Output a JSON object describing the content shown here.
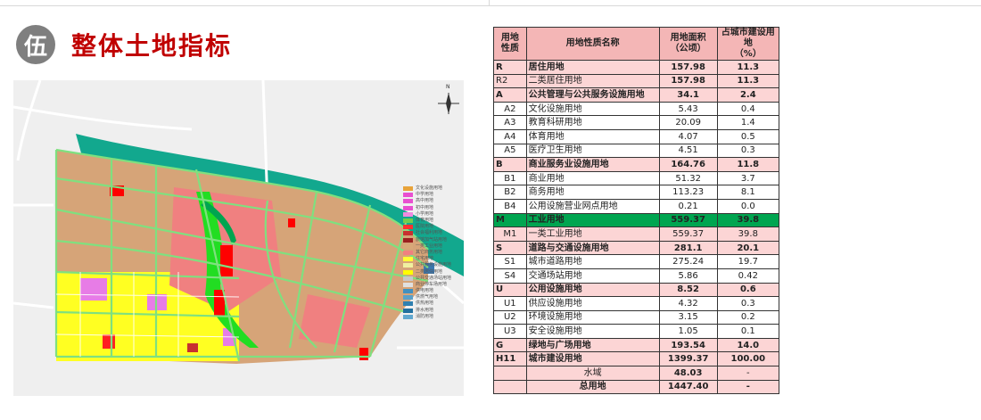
{
  "header": {
    "badge": "伍",
    "title": "整体土地指标"
  },
  "map": {
    "compass": "N",
    "legend": [
      {
        "label": "文化设施用地",
        "color": "#e8a33a"
      },
      {
        "label": "中学用地",
        "color": "#e84fd0"
      },
      {
        "label": "高中用地",
        "color": "#e84fd0"
      },
      {
        "label": "初中用地",
        "color": "#e84fd0"
      },
      {
        "label": "小学用地",
        "color": "#f08ae0"
      },
      {
        "label": "体育用地",
        "color": "#6fcf4f"
      },
      {
        "label": "医院用地",
        "color": "#ff3030"
      },
      {
        "label": "社会福利用地",
        "color": "#c83030"
      },
      {
        "label": "旅馆加气站用地",
        "color": "#9a2020"
      },
      {
        "label": "一类工业用地",
        "color": "#d8a878"
      },
      {
        "label": "其它商务用地",
        "color": "#f08080"
      },
      {
        "label": "住宅用地",
        "color": "#ffff33"
      },
      {
        "label": "公共服务设施用地",
        "color": "#f0f0a0"
      },
      {
        "label": "二类居住用地",
        "color": "#ffff00"
      },
      {
        "label": "公共交通场站用地",
        "color": "#c8c8c8"
      },
      {
        "label": "商业停车场用地",
        "color": "#e0e0e0"
      },
      {
        "label": "供电用地",
        "color": "#4090c0"
      },
      {
        "label": "供燃气用地",
        "color": "#5aa0c8"
      },
      {
        "label": "供热用地",
        "color": "#3080b0"
      },
      {
        "label": "排水用地",
        "color": "#2070a0"
      },
      {
        "label": "消防用地",
        "color": "#60a8d0"
      }
    ]
  },
  "table": {
    "headers": [
      "用地\n性质",
      "用地性质名称",
      "用地面积\n（公顷）",
      "占城市建设用地\n（%）"
    ],
    "rows": [
      {
        "code": "R",
        "name": "居住用地",
        "area": "157.98",
        "pct": "11.3",
        "kind": "main"
      },
      {
        "code": "R2",
        "name": "二类居住用地",
        "area": "157.98",
        "pct": "11.3",
        "kind": "plain"
      },
      {
        "code": "A",
        "name": "公共管理与公共服务设施用地",
        "area": "34.1",
        "pct": "2.4",
        "kind": "main"
      },
      {
        "code": "A2",
        "name": "文化设施用地",
        "area": "5.43",
        "pct": "0.4",
        "kind": "sub"
      },
      {
        "code": "A3",
        "name": "教育科研用地",
        "area": "20.09",
        "pct": "1.4",
        "kind": "sub"
      },
      {
        "code": "A4",
        "name": "体育用地",
        "area": "4.07",
        "pct": "0.5",
        "kind": "sub"
      },
      {
        "code": "A5",
        "name": "医疗卫生用地",
        "area": "4.51",
        "pct": "0.3",
        "kind": "sub"
      },
      {
        "code": "B",
        "name": "商业服务业设施用地",
        "area": "164.76",
        "pct": "11.8",
        "kind": "main"
      },
      {
        "code": "B1",
        "name": "商业用地",
        "area": "51.32",
        "pct": "3.7",
        "kind": "sub"
      },
      {
        "code": "B2",
        "name": "商务用地",
        "area": "113.23",
        "pct": "8.1",
        "kind": "sub"
      },
      {
        "code": "B4",
        "name": "公用设施营业网点用地",
        "area": "0.21",
        "pct": "0.0",
        "kind": "sub"
      },
      {
        "code": "M",
        "name": "工业用地",
        "area": "559.37",
        "pct": "39.8",
        "kind": "green"
      },
      {
        "code": "M1",
        "name": "一类工业用地",
        "area": "559.37",
        "pct": "39.8",
        "kind": "subplain"
      },
      {
        "code": "S",
        "name": "道路与交通设施用地",
        "area": "281.1",
        "pct": "20.1",
        "kind": "main"
      },
      {
        "code": "S1",
        "name": "城市道路用地",
        "area": "275.24",
        "pct": "19.7",
        "kind": "sub"
      },
      {
        "code": "S4",
        "name": "交通场站用地",
        "area": "5.86",
        "pct": "0.42",
        "kind": "sub"
      },
      {
        "code": "U",
        "name": "公用设施用地",
        "area": "8.52",
        "pct": "0.6",
        "kind": "main"
      },
      {
        "code": "U1",
        "name": "供应设施用地",
        "area": "4.32",
        "pct": "0.3",
        "kind": "sub"
      },
      {
        "code": "U2",
        "name": "环境设施用地",
        "area": "3.15",
        "pct": "0.2",
        "kind": "sub"
      },
      {
        "code": "U3",
        "name": "安全设施用地",
        "area": "1.05",
        "pct": "0.1",
        "kind": "sub"
      },
      {
        "code": "G",
        "name": "绿地与广场用地",
        "area": "193.54",
        "pct": "14.0",
        "kind": "main"
      },
      {
        "code": "H11",
        "name": "城市建设用地",
        "area": "1399.37",
        "pct": "100.00",
        "kind": "main"
      },
      {
        "code": "",
        "name": "水域",
        "area": "48.03",
        "pct": "-",
        "kind": "centered"
      },
      {
        "code": "",
        "name": "总用地",
        "area": "1447.40",
        "pct": "-",
        "kind": "centeredbold"
      }
    ]
  }
}
